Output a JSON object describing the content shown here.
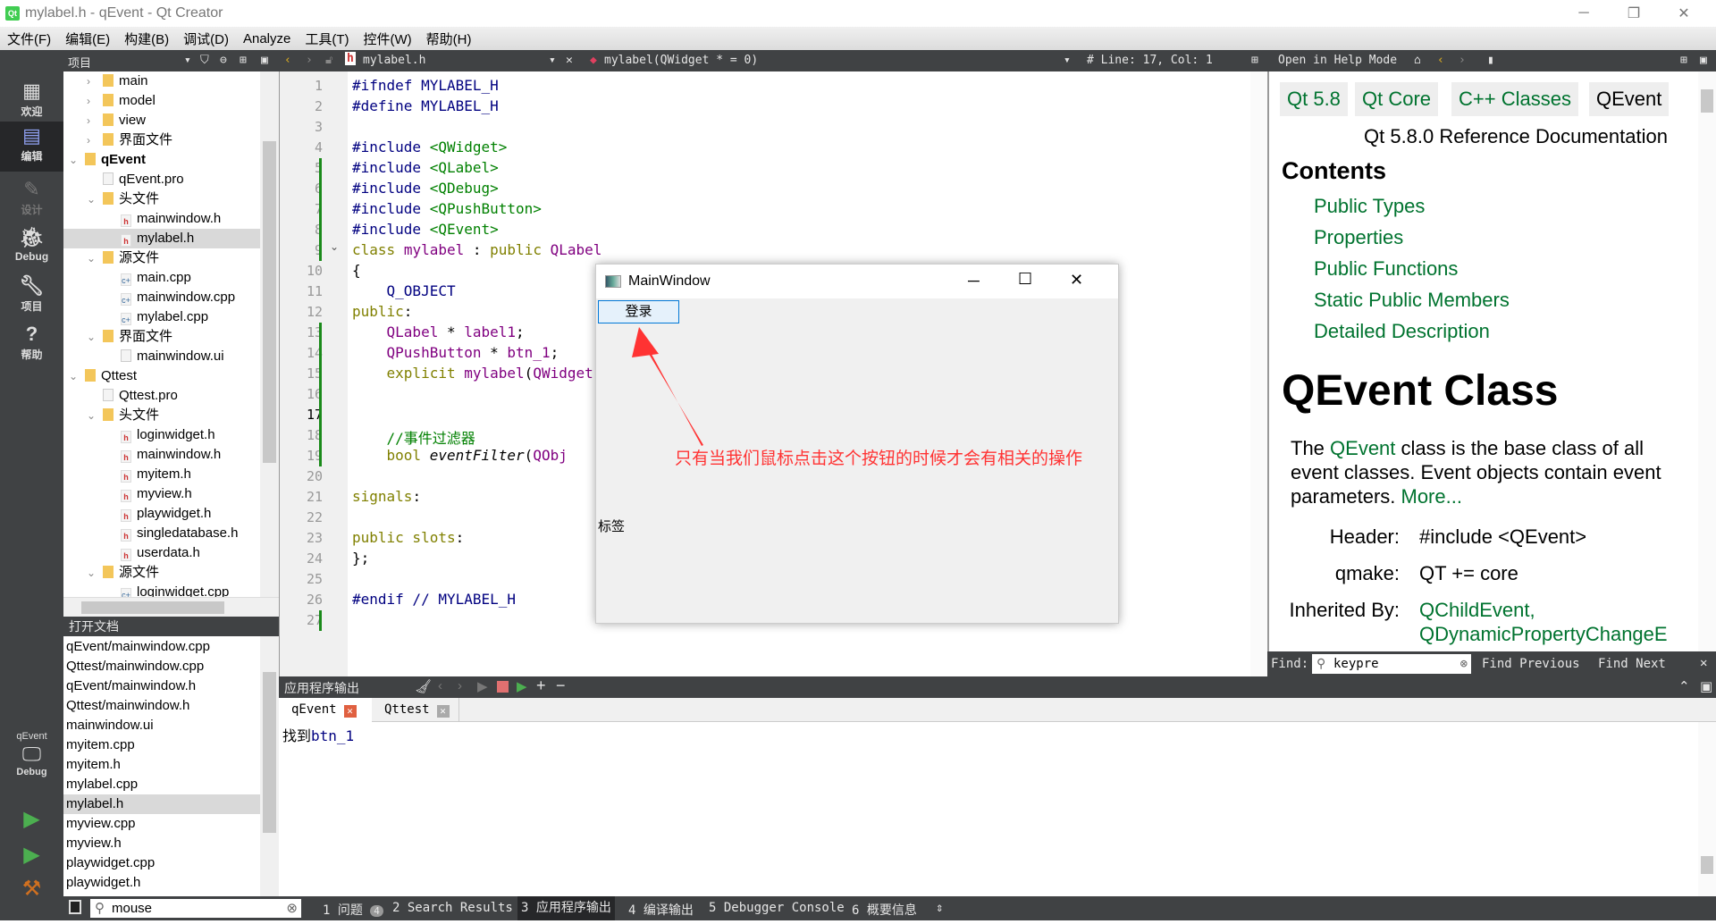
{
  "window": {
    "title": "mylabel.h - qEvent - Qt Creator"
  },
  "menu": [
    "文件(F)",
    "编辑(E)",
    "构建(B)",
    "调试(D)",
    "Analyze",
    "工具(T)",
    "控件(W)",
    "帮助(H)"
  ],
  "toolbar": {
    "project_label": "项目",
    "file": "mylabel.h",
    "symbol": "mylabel(QWidget * = 0)",
    "cursor": "# Line: 17, Col: 1",
    "help_mode": "Open in Help Mode"
  },
  "modes": [
    {
      "label": "欢迎",
      "icon": "grid-icon"
    },
    {
      "label": "编辑",
      "icon": "edit-icon"
    },
    {
      "label": "设计",
      "icon": "pencil-icon"
    },
    {
      "label": "Debug",
      "icon": "bug-icon"
    },
    {
      "label": "项目",
      "icon": "wrench-icon"
    },
    {
      "label": "帮助",
      "icon": "help-icon"
    }
  ],
  "kit": {
    "project": "qEvent",
    "mode": "Debug"
  },
  "tree": [
    {
      "label": "main",
      "depth": 1,
      "arrow": "›",
      "icon": "folder"
    },
    {
      "label": "model",
      "depth": 1,
      "arrow": "›",
      "icon": "folder"
    },
    {
      "label": "view",
      "depth": 1,
      "arrow": "›",
      "icon": "folder"
    },
    {
      "label": "界面文件",
      "depth": 1,
      "arrow": "›",
      "icon": "folder"
    },
    {
      "label": "qEvent",
      "depth": 0,
      "arrow": "⌄",
      "icon": "folder",
      "bold": true
    },
    {
      "label": "qEvent.pro",
      "depth": 1,
      "arrow": "",
      "icon": "pro"
    },
    {
      "label": "头文件",
      "depth": 1,
      "arrow": "⌄",
      "icon": "folder"
    },
    {
      "label": "mainwindow.h",
      "depth": 2,
      "arrow": "",
      "icon": "h"
    },
    {
      "label": "mylabel.h",
      "depth": 2,
      "arrow": "",
      "icon": "h",
      "selected": true
    },
    {
      "label": "源文件",
      "depth": 1,
      "arrow": "⌄",
      "icon": "folder"
    },
    {
      "label": "main.cpp",
      "depth": 2,
      "arrow": "",
      "icon": "cpp"
    },
    {
      "label": "mainwindow.cpp",
      "depth": 2,
      "arrow": "",
      "icon": "cpp"
    },
    {
      "label": "mylabel.cpp",
      "depth": 2,
      "arrow": "",
      "icon": "cpp"
    },
    {
      "label": "界面文件",
      "depth": 1,
      "arrow": "⌄",
      "icon": "folder"
    },
    {
      "label": "mainwindow.ui",
      "depth": 2,
      "arrow": "",
      "icon": "pro"
    },
    {
      "label": "Qttest",
      "depth": 0,
      "arrow": "⌄",
      "icon": "folder"
    },
    {
      "label": "Qttest.pro",
      "depth": 1,
      "arrow": "",
      "icon": "pro"
    },
    {
      "label": "头文件",
      "depth": 1,
      "arrow": "⌄",
      "icon": "folder"
    },
    {
      "label": "loginwidget.h",
      "depth": 2,
      "arrow": "",
      "icon": "h"
    },
    {
      "label": "mainwindow.h",
      "depth": 2,
      "arrow": "",
      "icon": "h"
    },
    {
      "label": "myitem.h",
      "depth": 2,
      "arrow": "",
      "icon": "h"
    },
    {
      "label": "myview.h",
      "depth": 2,
      "arrow": "",
      "icon": "h"
    },
    {
      "label": "playwidget.h",
      "depth": 2,
      "arrow": "",
      "icon": "h"
    },
    {
      "label": "singledatabase.h",
      "depth": 2,
      "arrow": "",
      "icon": "h"
    },
    {
      "label": "userdata.h",
      "depth": 2,
      "arrow": "",
      "icon": "h"
    },
    {
      "label": "源文件",
      "depth": 1,
      "arrow": "⌄",
      "icon": "folder"
    },
    {
      "label": "loginwidget.cpp",
      "depth": 2,
      "arrow": "",
      "icon": "cpp"
    }
  ],
  "open_docs": {
    "title": "打开文档",
    "items": [
      "qEvent/mainwindow.cpp",
      "Qttest/mainwindow.cpp",
      "qEvent/mainwindow.h",
      "Qttest/mainwindow.h",
      "mainwindow.ui",
      "myitem.cpp",
      "myitem.h",
      "mylabel.cpp",
      "mylabel.h",
      "myview.cpp",
      "myview.h",
      "playwidget.cpp",
      "playwidget.h"
    ],
    "selected": "mylabel.h"
  },
  "code": [
    "<span class=pp>#ifndef MYLABEL_H</span>",
    "<span class=pp>#define MYLABEL_H</span>",
    "",
    "<span class=pp>#include </span><span class=st>&lt;QWidget&gt;</span>",
    "<span class=pp>#include </span><span class=st>&lt;QLabel&gt;</span>",
    "<span class=pp>#include </span><span class=st>&lt;QDebug&gt;</span>",
    "<span class=pp>#include </span><span class=st>&lt;QPushButton&gt;</span>",
    "<span class=pp>#include </span><span class=st>&lt;QEvent&gt;</span>",
    "<span class=kw>class</span> <span class=ty>mylabel</span> : <span class=kw>public</span> <span class=ty>QLabel</span>",
    "{",
    "    <span class=pp>Q_OBJECT</span>",
    "<span class=kw>public</span>:",
    "    <span class=ty>QLabel</span> * <span class=ty>label1</span>;",
    "    <span class=ty>QPushButton</span> * <span class=ty>btn_1</span>;",
    "    <span class=kw>explicit</span> <span class=ty>mylabel</span>(<span class=ty>QWidget</span>",
    "",
    "",
    "    <span class=cm>//事件过滤器</span>",
    "    <span class=kw>bool</span> <i>eventFilter</i>(<span class=ty>QObj</span>",
    "",
    "<span class=kw>signals</span>:",
    "",
    "<span class=kw>public slots</span>:",
    "};",
    "",
    "<span class=pp>#endif // MYLABEL_H</span>",
    ""
  ],
  "popup": {
    "title": "MainWindow",
    "button": "登录",
    "label": "标签",
    "annotation": "只有当我们鼠标点击这个按钮的时候才会有相关的操作",
    "annotation_color": "#ff3333"
  },
  "help": {
    "crumbs": [
      "Qt 5.8",
      "Qt Core",
      "C++ Classes",
      "QEvent"
    ],
    "ref": "Qt 5.8.0 Reference Documentation",
    "contents_title": "Contents",
    "contents": [
      "Public Types",
      "Properties",
      "Public Functions",
      "Static Public Members",
      "Detailed Description"
    ],
    "class_title": "QEvent Class",
    "desc_pre": "The ",
    "desc_link": "QEvent",
    "desc_post": " class is the base class of all event classes. Event objects contain event parameters. ",
    "more": "More...",
    "header_k": "Header:",
    "header_v": "#include <QEvent>",
    "qmake_k": "qmake:",
    "qmake_v": "QT += core",
    "inh_k": "Inherited By:",
    "inh_v1": "QChildEvent,",
    "inh_v2": "QDynamicPropertyChangeE"
  },
  "find": {
    "label": "Find:",
    "value": "keypre",
    "prev": "Find Previous",
    "next": "Find Next"
  },
  "output": {
    "title": "应用程序输出",
    "tabs": [
      "qEvent",
      "Qttest"
    ],
    "text_pre": "找到",
    "text_code": "btn_1"
  },
  "status": {
    "search": "mouse",
    "tabs": [
      "1 问题",
      "2 Search Results",
      "3 应用程序输出",
      "4 编译输出",
      "5 Debugger Console",
      "6 概要信息"
    ],
    "issues_count": "4"
  }
}
